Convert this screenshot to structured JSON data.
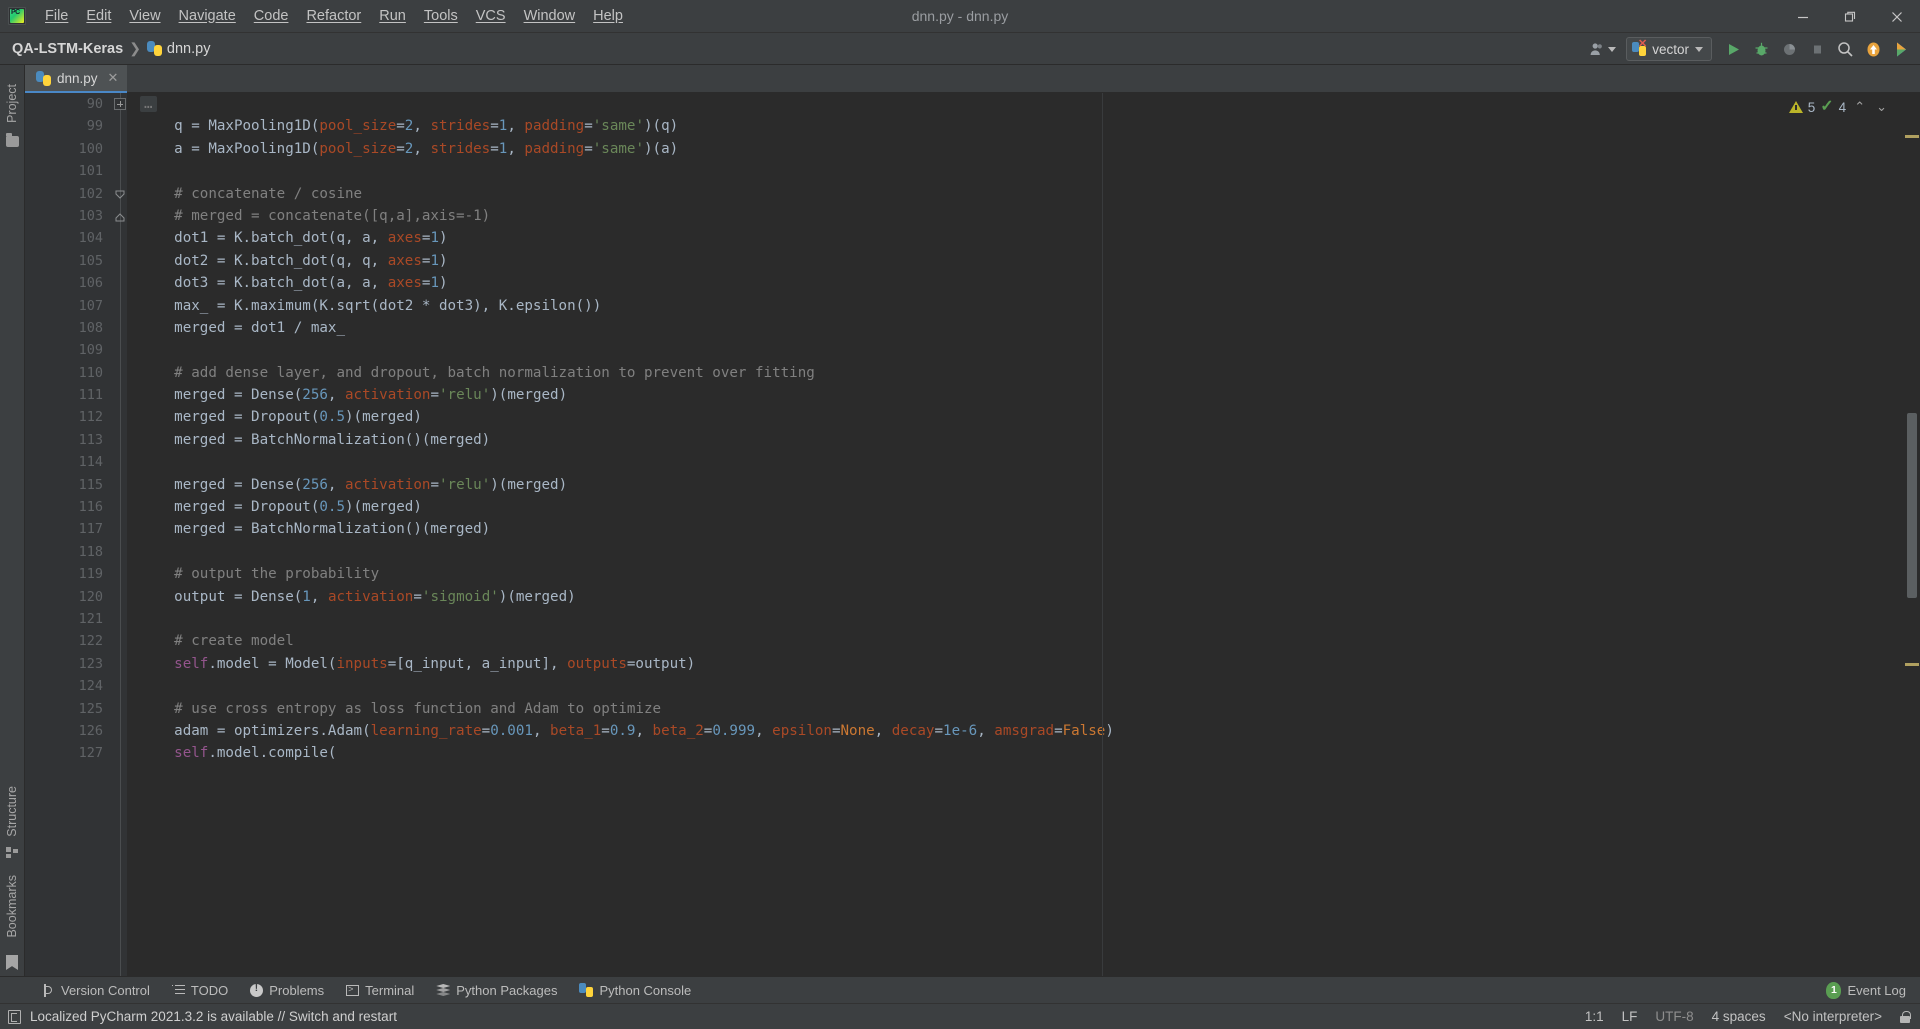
{
  "window": {
    "title": "dnn.py - dnn.py",
    "minimize_label": "—",
    "maximize_label": "❐",
    "close_label": "✕"
  },
  "menu": {
    "items": [
      {
        "label": "File",
        "mnemonic": "F"
      },
      {
        "label": "Edit",
        "mnemonic": "E"
      },
      {
        "label": "View",
        "mnemonic": "V"
      },
      {
        "label": "Navigate",
        "mnemonic": "N"
      },
      {
        "label": "Code",
        "mnemonic": "C"
      },
      {
        "label": "Refactor",
        "mnemonic": "R"
      },
      {
        "label": "Run",
        "mnemonic": "u"
      },
      {
        "label": "Tools",
        "mnemonic": "T"
      },
      {
        "label": "VCS",
        "mnemonic": "S"
      },
      {
        "label": "Window",
        "mnemonic": "W"
      },
      {
        "label": "Help",
        "mnemonic": "H"
      }
    ]
  },
  "navbar": {
    "project": "QA-LSTM-Keras",
    "separator": "❯",
    "file": "dnn.py",
    "run_config": "vector",
    "icons": {
      "account": "account-icon",
      "run": "run-icon",
      "debug": "debug-icon",
      "coverage": "run-coverage-icon",
      "stop": "stop-icon",
      "search": "search-icon",
      "update": "update-project-icon",
      "ide_feature": "ide-feature-icon"
    }
  },
  "left_strip": {
    "project_label": "Project",
    "structure_label": "Structure",
    "bookmarks_label": "Bookmarks"
  },
  "tabs": [
    {
      "label": "dnn.py",
      "close": "✕",
      "active": true
    }
  ],
  "inspection": {
    "warning_count": "5",
    "ok_count": "4",
    "prev": "⌃",
    "next": "⌄"
  },
  "editor": {
    "first_line_number": 90,
    "lines": [
      {
        "num": "90",
        "fold": "plus",
        "tokens": [
          {
            "t": "…",
            "c": "elip"
          }
        ]
      },
      {
        "num": "99",
        "fold": "",
        "tokens": [
          {
            "t": "    q = MaxPooling1D(",
            "c": "pl"
          },
          {
            "t": "pool_size",
            "c": "kwarg"
          },
          {
            "t": "=",
            "c": "pl"
          },
          {
            "t": "2",
            "c": "num"
          },
          {
            "t": ", ",
            "c": "pl"
          },
          {
            "t": "strides",
            "c": "kwarg"
          },
          {
            "t": "=",
            "c": "pl"
          },
          {
            "t": "1",
            "c": "num"
          },
          {
            "t": ", ",
            "c": "pl"
          },
          {
            "t": "padding",
            "c": "kwarg"
          },
          {
            "t": "=",
            "c": "pl"
          },
          {
            "t": "'same'",
            "c": "str"
          },
          {
            "t": ")(q)",
            "c": "pl"
          }
        ]
      },
      {
        "num": "100",
        "fold": "",
        "tokens": [
          {
            "t": "    a = MaxPooling1D(",
            "c": "pl"
          },
          {
            "t": "pool_size",
            "c": "kwarg"
          },
          {
            "t": "=",
            "c": "pl"
          },
          {
            "t": "2",
            "c": "num"
          },
          {
            "t": ", ",
            "c": "pl"
          },
          {
            "t": "strides",
            "c": "kwarg"
          },
          {
            "t": "=",
            "c": "pl"
          },
          {
            "t": "1",
            "c": "num"
          },
          {
            "t": ", ",
            "c": "pl"
          },
          {
            "t": "padding",
            "c": "kwarg"
          },
          {
            "t": "=",
            "c": "pl"
          },
          {
            "t": "'same'",
            "c": "str"
          },
          {
            "t": ")(a)",
            "c": "pl"
          }
        ]
      },
      {
        "num": "101",
        "fold": "",
        "tokens": []
      },
      {
        "num": "102",
        "fold": "vdown",
        "tokens": [
          {
            "t": "    # concatenate / cosine",
            "c": "cmt"
          }
        ]
      },
      {
        "num": "103",
        "fold": "vup",
        "tokens": [
          {
            "t": "    # merged = concatenate([q,a],axis=-1)",
            "c": "cmt"
          }
        ]
      },
      {
        "num": "104",
        "fold": "",
        "tokens": [
          {
            "t": "    dot1 = K.batch_dot(q, a, ",
            "c": "pl"
          },
          {
            "t": "axes",
            "c": "kwarg"
          },
          {
            "t": "=",
            "c": "pl"
          },
          {
            "t": "1",
            "c": "num"
          },
          {
            "t": ")",
            "c": "pl"
          }
        ]
      },
      {
        "num": "105",
        "fold": "",
        "tokens": [
          {
            "t": "    dot2 = K.batch_dot(q, q, ",
            "c": "pl"
          },
          {
            "t": "axes",
            "c": "kwarg"
          },
          {
            "t": "=",
            "c": "pl"
          },
          {
            "t": "1",
            "c": "num"
          },
          {
            "t": ")",
            "c": "pl"
          }
        ]
      },
      {
        "num": "106",
        "fold": "",
        "tokens": [
          {
            "t": "    dot3 = K.batch_dot(a, a, ",
            "c": "pl"
          },
          {
            "t": "axes",
            "c": "kwarg"
          },
          {
            "t": "=",
            "c": "pl"
          },
          {
            "t": "1",
            "c": "num"
          },
          {
            "t": ")",
            "c": "pl"
          }
        ]
      },
      {
        "num": "107",
        "fold": "",
        "tokens": [
          {
            "t": "    max_ = K.maximum(K.sqrt(dot2 * dot3), K.epsilon())",
            "c": "pl"
          }
        ]
      },
      {
        "num": "108",
        "fold": "",
        "tokens": [
          {
            "t": "    merged = dot1 / max_",
            "c": "pl"
          }
        ]
      },
      {
        "num": "109",
        "fold": "",
        "tokens": []
      },
      {
        "num": "110",
        "fold": "",
        "tokens": [
          {
            "t": "    # add dense layer, and dropout, batch normalization to prevent over fitting",
            "c": "cmt"
          }
        ]
      },
      {
        "num": "111",
        "fold": "",
        "tokens": [
          {
            "t": "    merged = Dense(",
            "c": "pl"
          },
          {
            "t": "256",
            "c": "num"
          },
          {
            "t": ", ",
            "c": "pl"
          },
          {
            "t": "activation",
            "c": "kwarg"
          },
          {
            "t": "=",
            "c": "pl"
          },
          {
            "t": "'relu'",
            "c": "str"
          },
          {
            "t": ")(merged)",
            "c": "pl"
          }
        ]
      },
      {
        "num": "112",
        "fold": "",
        "tokens": [
          {
            "t": "    merged = Dropout(",
            "c": "pl"
          },
          {
            "t": "0.5",
            "c": "num"
          },
          {
            "t": ")(merged)",
            "c": "pl"
          }
        ]
      },
      {
        "num": "113",
        "fold": "",
        "tokens": [
          {
            "t": "    merged = BatchNormalization()(merged)",
            "c": "pl"
          }
        ]
      },
      {
        "num": "114",
        "fold": "",
        "tokens": []
      },
      {
        "num": "115",
        "fold": "",
        "tokens": [
          {
            "t": "    merged = Dense(",
            "c": "pl"
          },
          {
            "t": "256",
            "c": "num"
          },
          {
            "t": ", ",
            "c": "pl"
          },
          {
            "t": "activation",
            "c": "kwarg"
          },
          {
            "t": "=",
            "c": "pl"
          },
          {
            "t": "'relu'",
            "c": "str"
          },
          {
            "t": ")(merged)",
            "c": "pl"
          }
        ]
      },
      {
        "num": "116",
        "fold": "",
        "tokens": [
          {
            "t": "    merged = Dropout(",
            "c": "pl"
          },
          {
            "t": "0.5",
            "c": "num"
          },
          {
            "t": ")(merged)",
            "c": "pl"
          }
        ]
      },
      {
        "num": "117",
        "fold": "",
        "tokens": [
          {
            "t": "    merged = BatchNormalization()(merged)",
            "c": "pl"
          }
        ]
      },
      {
        "num": "118",
        "fold": "",
        "tokens": []
      },
      {
        "num": "119",
        "fold": "",
        "tokens": [
          {
            "t": "    # output the probability",
            "c": "cmt"
          }
        ]
      },
      {
        "num": "120",
        "fold": "",
        "tokens": [
          {
            "t": "    output = Dense(",
            "c": "pl"
          },
          {
            "t": "1",
            "c": "num"
          },
          {
            "t": ", ",
            "c": "pl"
          },
          {
            "t": "activation",
            "c": "kwarg"
          },
          {
            "t": "=",
            "c": "pl"
          },
          {
            "t": "'sigmoid'",
            "c": "str"
          },
          {
            "t": ")(merged)",
            "c": "pl"
          }
        ]
      },
      {
        "num": "121",
        "fold": "",
        "tokens": []
      },
      {
        "num": "122",
        "fold": "",
        "tokens": [
          {
            "t": "    # create model",
            "c": "cmt"
          }
        ]
      },
      {
        "num": "123",
        "fold": "",
        "tokens": [
          {
            "t": "    ",
            "c": "pl"
          },
          {
            "t": "self",
            "c": "self"
          },
          {
            "t": ".model = Model(",
            "c": "pl"
          },
          {
            "t": "inputs",
            "c": "kwarg"
          },
          {
            "t": "=[q_input, a_input], ",
            "c": "pl"
          },
          {
            "t": "outputs",
            "c": "kwarg"
          },
          {
            "t": "=output)",
            "c": "pl"
          }
        ]
      },
      {
        "num": "124",
        "fold": "",
        "tokens": []
      },
      {
        "num": "125",
        "fold": "",
        "tokens": [
          {
            "t": "    # use cross entropy as loss function and Adam to optimize",
            "c": "cmt"
          }
        ]
      },
      {
        "num": "126",
        "fold": "",
        "tokens": [
          {
            "t": "    adam = optimizers.Adam(",
            "c": "pl"
          },
          {
            "t": "learning_rate",
            "c": "kwarg"
          },
          {
            "t": "=",
            "c": "pl"
          },
          {
            "t": "0.001",
            "c": "num"
          },
          {
            "t": ", ",
            "c": "pl"
          },
          {
            "t": "beta_1",
            "c": "kwarg"
          },
          {
            "t": "=",
            "c": "pl"
          },
          {
            "t": "0.9",
            "c": "num"
          },
          {
            "t": ", ",
            "c": "pl"
          },
          {
            "t": "beta_2",
            "c": "kwarg"
          },
          {
            "t": "=",
            "c": "pl"
          },
          {
            "t": "0.999",
            "c": "num"
          },
          {
            "t": ", ",
            "c": "pl"
          },
          {
            "t": "epsilon",
            "c": "kwarg"
          },
          {
            "t": "=",
            "c": "pl"
          },
          {
            "t": "None",
            "c": "k"
          },
          {
            "t": ", ",
            "c": "pl"
          },
          {
            "t": "decay",
            "c": "kwarg"
          },
          {
            "t": "=",
            "c": "pl"
          },
          {
            "t": "1e-6",
            "c": "num"
          },
          {
            "t": ", ",
            "c": "pl"
          },
          {
            "t": "amsgrad",
            "c": "kwarg"
          },
          {
            "t": "=",
            "c": "pl"
          },
          {
            "t": "False",
            "c": "k"
          },
          {
            "t": ")",
            "c": "pl"
          }
        ]
      },
      {
        "num": "127",
        "fold": "",
        "tokens": [
          {
            "t": "    ",
            "c": "pl"
          },
          {
            "t": "self",
            "c": "self"
          },
          {
            "t": ".model.compile(",
            "c": "pl"
          }
        ]
      }
    ]
  },
  "bottom_bar": {
    "items": [
      {
        "label": "Version Control",
        "icon": "branch-icon"
      },
      {
        "label": "TODO",
        "icon": "todo-icon"
      },
      {
        "label": "Problems",
        "icon": "problems-icon"
      },
      {
        "label": "Terminal",
        "icon": "terminal-icon"
      },
      {
        "label": "Python Packages",
        "icon": "packages-icon"
      },
      {
        "label": "Python Console",
        "icon": "python-console-icon"
      }
    ],
    "event_log": {
      "label": "Event Log",
      "count": "1"
    }
  },
  "status_bar": {
    "message": "Localized PyCharm 2021.3.2 is available // Switch and restart",
    "caret_position": "1:1",
    "line_separator": "LF",
    "encoding": "UTF-8",
    "indent": "4 spaces",
    "interpreter": "<No interpreter>",
    "lock": "read-only-toggle"
  },
  "colors": {
    "chrome": "#3c3f41",
    "editor_bg": "#2b2b2b",
    "gutter_bg": "#313335",
    "accent": "#4a88c7",
    "keyword": "#cc7832",
    "string": "#6a8759",
    "number": "#6897bb",
    "comment": "#808080",
    "kwarg": "#aa4926",
    "self": "#94558d",
    "warning": "#bbb529",
    "ok": "#5a9e52"
  }
}
